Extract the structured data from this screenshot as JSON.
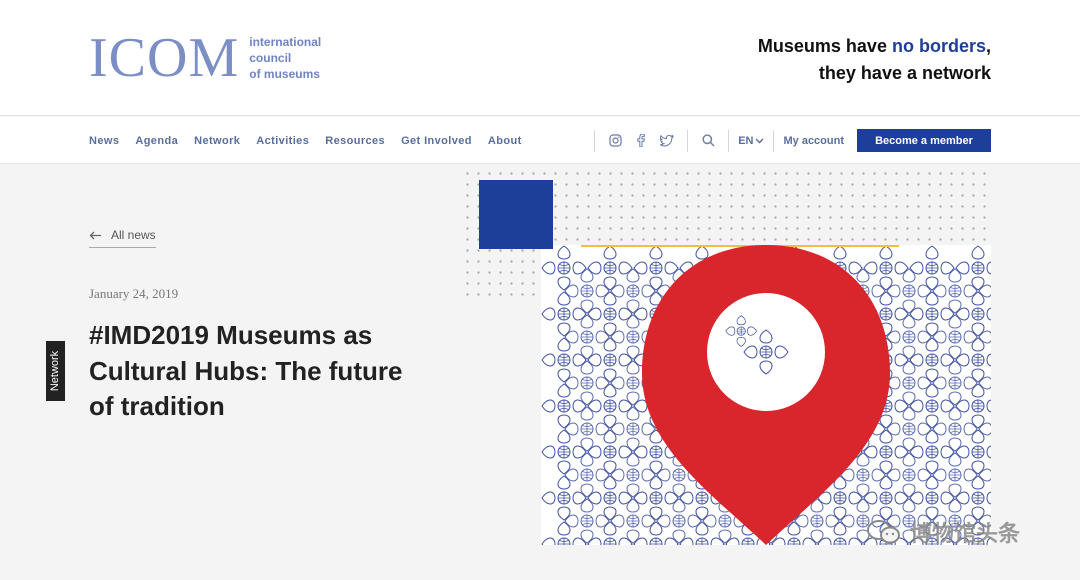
{
  "brand": {
    "logo_word": "ICOM",
    "logo_sub_1": "international",
    "logo_sub_2": "council",
    "logo_sub_3": "of museums"
  },
  "tagline": {
    "part1": "Museums have ",
    "highlight": "no borders",
    "part2": ",",
    "line2": "they have a network"
  },
  "nav": {
    "links": [
      "News",
      "Agenda",
      "Network",
      "Activities",
      "Resources",
      "Get Involved",
      "About"
    ],
    "language": "EN",
    "account": "My account",
    "member_button": "Become a member"
  },
  "social_icons": [
    "instagram-icon",
    "facebook-icon",
    "twitter-icon"
  ],
  "article": {
    "back_label": "All news",
    "date": "January 24, 2019",
    "title": "#IMD2019 Museums as Cultural Hubs: The future of tradition",
    "category": "Network"
  },
  "watermark": {
    "text": "博物馆头条"
  },
  "colors": {
    "brand_blue": "#1d3f9a",
    "logo_blue": "#7b8fc6",
    "pin_red": "#d9262c",
    "pattern_stroke": "#3d4fa0"
  }
}
